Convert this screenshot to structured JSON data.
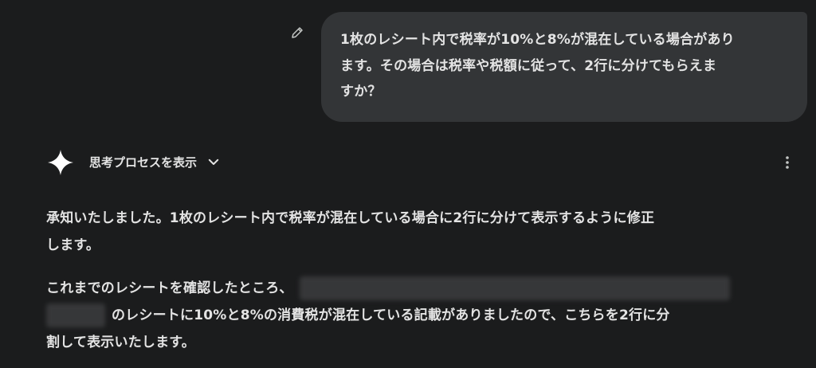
{
  "user_message": {
    "lines": [
      "1枚のレシート内で税率が10%と8%が混在している場合があり",
      "ます。その場合は税率や税額に従って、2行に分けてもらえま",
      "すか？"
    ]
  },
  "model_header": {
    "thinking_label": "思考プロセスを表示"
  },
  "response": {
    "para1_lines": [
      "承知いたしました。1枚のレシート内で税率が混在している場合に2行に分けて表示するように修正",
      "します。"
    ],
    "para2_line1": "これまでのレシートを確認したところ、",
    "para2_line2": "のレシートに10%と8%の消費税が混在している記載がありましたので、こちらを2行に分",
    "para2_line3": "割して表示いたします。"
  },
  "icons": {
    "edit": "pencil-icon",
    "spark": "gemini-spark-icon",
    "chevron": "chevron-down-icon",
    "more": "more-vert-icon"
  },
  "colors": {
    "background": "#1b1c1d",
    "bubble": "#333537",
    "text": "#e3e3e3"
  }
}
